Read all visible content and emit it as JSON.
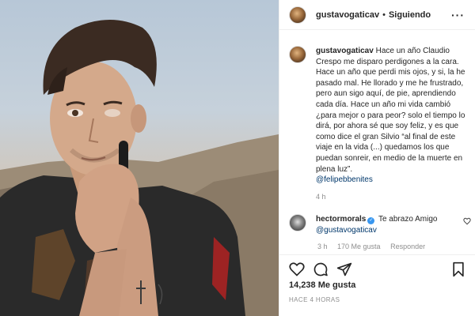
{
  "post": {
    "username": "gustavogaticav",
    "follow_status": "Siguiendo",
    "caption": {
      "username": "gustavogaticav",
      "text": "Hace un año Claudio Crespo me disparo perdigones a la cara. Hace un año que perdi mis ojos, y si, la he pasado mal. He llorado y me he frustrado, pero aun sigo aquí, de pie, aprendiendo cada día. Hace un año mi vida cambió ¿para mejor o para peor? solo el tiempo lo dirá, por ahora sé que soy feliz, y es que como dice el gran Silvio “al final de este viaje en la vida (...) quedamos los que puedan sonreir, en medio de la muerte en plena luz”.",
      "mention": "@felipebbenites",
      "time": "4 h"
    },
    "comment": {
      "username": "hectormorals",
      "text": "Te abrazo Amigo",
      "mention": "@gustavogaticav",
      "time": "3 h",
      "likes": "170 Me gusta",
      "reply": "Responder"
    },
    "likes_count": "14,238 Me gusta",
    "posted_ago": "HACE 4 HORAS"
  },
  "icons": {
    "more": "more-options-icon",
    "heart": "heart-icon",
    "comment": "comment-icon",
    "share": "share-icon",
    "save": "bookmark-icon",
    "verified": "verified-badge-icon"
  },
  "colors": {
    "text": "#262626",
    "muted": "#8e8e8e",
    "link": "#00376b",
    "verified": "#3897f0",
    "divider": "#efefef"
  }
}
